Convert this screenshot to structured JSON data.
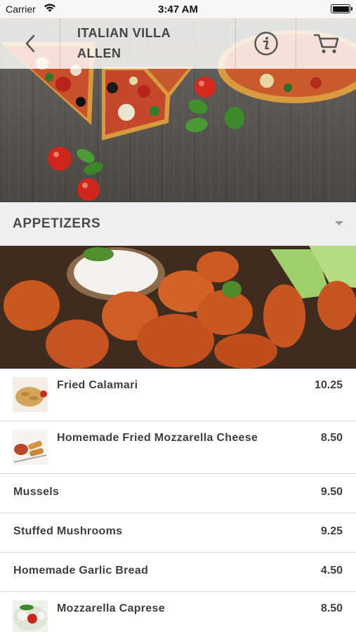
{
  "status_bar": {
    "carrier": "Carrier",
    "time": "3:47 AM"
  },
  "nav": {
    "title_line1": "ITALIAN VILLA",
    "title_line2": "ALLEN",
    "icons": [
      "back-chevron-icon",
      "info-icon",
      "cart-icon"
    ]
  },
  "category": {
    "title": "APPETIZERS"
  },
  "menu_items": [
    {
      "name": "Fried Calamari",
      "price": "10.25",
      "has_thumb": true
    },
    {
      "name": "Homemade Fried Mozzarella Cheese",
      "price": "8.50",
      "has_thumb": true
    },
    {
      "name": "Mussels",
      "price": "9.50",
      "has_thumb": false
    },
    {
      "name": "Stuffed Mushrooms",
      "price": "9.25",
      "has_thumb": false
    },
    {
      "name": "Homemade Garlic Bread",
      "price": "4.50",
      "has_thumb": false
    },
    {
      "name": "Mozzarella Caprese",
      "price": "8.50",
      "has_thumb": true
    }
  ],
  "colors": {
    "nav_overlay": "#ffffff",
    "category_bar": "#efefef",
    "text": "#3e3e3e",
    "divider": "#dcdcdc"
  }
}
